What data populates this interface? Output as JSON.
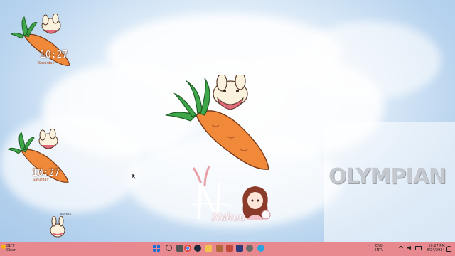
{
  "widgets": {
    "clock_top": {
      "time": "10:27",
      "sub": "Saturday"
    },
    "clock_mid": {
      "time": "10:27",
      "sub": "Saturday"
    }
  },
  "wallpaper": {
    "logo_text": "OLYMPIAN",
    "signature_text": "Nakuu"
  },
  "desktop_icons": [
    {
      "label": "Nikkhan"
    }
  ],
  "weather": {
    "temp": "81°F",
    "condition": "Clear"
  },
  "taskbar": {
    "icons": [
      "start",
      "search",
      "task-view",
      "chrome",
      "steam",
      "file-explorer",
      "mail",
      "photos",
      "store",
      "settings",
      "telegram"
    ],
    "colors": {
      "start": "#1a6fd6",
      "chrome": "#e6453a",
      "steam": "#1b2838",
      "file-explorer": "#f2c14e",
      "telegram": "#2aa4de"
    }
  },
  "tray": {
    "lang": "ENG",
    "region": "INTL",
    "time": "10:27 PM",
    "date": "8/24/2024"
  },
  "colors": {
    "taskbar": "#e7898e",
    "carrot": "#f08a3a",
    "leaves": "#3fa64a"
  }
}
